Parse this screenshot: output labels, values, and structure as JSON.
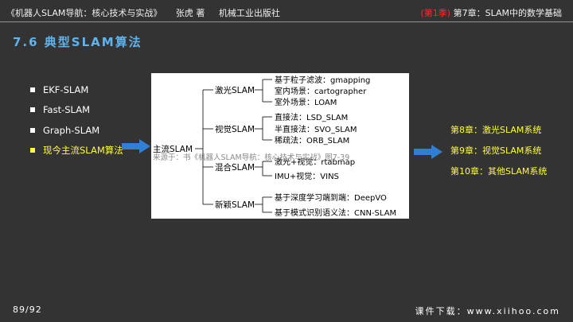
{
  "header": {
    "book": "《机器人SLAM导航：核心技术与实战》",
    "author": "张虎 著",
    "publisher": "机械工业出版社",
    "part": "(第1季)",
    "chapter": "第7章：SLAM中的数学基础"
  },
  "slide": {
    "title": "7.6 典型SLAM算法"
  },
  "bullets": [
    {
      "label": "EKF-SLAM"
    },
    {
      "label": "Fast-SLAM"
    },
    {
      "label": "Graph-SLAM"
    },
    {
      "label": "现今主流SLAM算法"
    }
  ],
  "diagram": {
    "root": "主流SLAM",
    "caption": "来源于：书《机器人SLAM导航：核心技术与实战》图7-39",
    "groups": [
      {
        "name": "激光SLAM",
        "items": [
          "基于粒子滤波：gmapping",
          "室内场景：cartographer",
          "室外场景：LOAM"
        ]
      },
      {
        "name": "视觉SLAM",
        "items": [
          "直接法：LSD_SLAM",
          "半直接法：SVO_SLAM",
          "稀疏法：ORB_SLAM"
        ]
      },
      {
        "name": "混合SLAM",
        "items": [
          "激光+视觉：rtabmap",
          "IMU+视觉：VINS"
        ]
      },
      {
        "name": "新颖SLAM",
        "items": [
          "基于深度学习端到端：DeepVO",
          "基于模式识别语义法：CNN-SLAM"
        ]
      }
    ]
  },
  "chapters": [
    {
      "label": "第8章：激光SLAM系统"
    },
    {
      "label": "第9章：视觉SLAM系统"
    },
    {
      "label": "第10章：其他SLAM系统"
    }
  ],
  "footer": {
    "page": "89/92",
    "site": "课件下载：www.xiihoo.com"
  },
  "colors": {
    "background": "#333333",
    "title": "#5fb3ee",
    "highlight": "#ffff33",
    "accent_red": "#ff2a2a",
    "arrow": "#2f7fd6"
  }
}
